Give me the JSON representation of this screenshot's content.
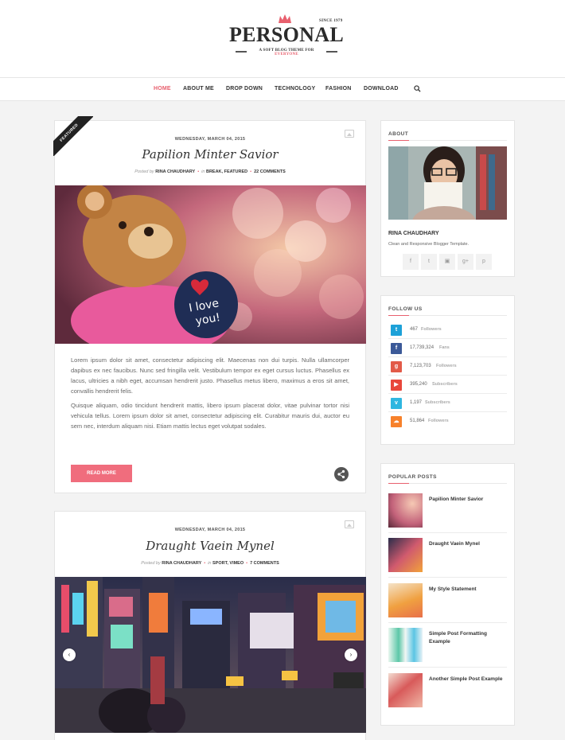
{
  "site": {
    "title": "PERSONAL",
    "since": "SINCE 1979",
    "tagline_prefix": "A SOFT BLOG THEME FOR ",
    "tagline_highlight": "EVERYONE"
  },
  "nav": {
    "items": [
      "HOME",
      "ABOUT ME",
      "DROP DOWN",
      "TECHNOLOGY",
      "FASHION",
      "DOWNLOAD"
    ]
  },
  "posts": [
    {
      "ribbon": "FEATURED",
      "date": "WEDNESDAY, MARCH 04, 2015",
      "title": "Papilion Minter Savior",
      "posted_by_label": "Posted by",
      "author": "RINA CHAUDHARY",
      "in_label": "in",
      "categories": "BREAK, FEATURED",
      "comments": "22 COMMENTS",
      "paragraphs": [
        "Lorem ipsum dolor sit amet, consectetur adipiscing elit. Maecenas non dui turpis. Nulla ullamcorper dapibus ex nec faucibus. Nunc sed fringilla velit. Vestibulum tempor ex eget cursus luctus. Phasellus ex lacus, ultricies a nibh eget, accumsan hendrerit justo. Phasellus metus libero, maximus a eros sit amet, convallis hendrerit felis.",
        "Quisque aliquam, odio tincidunt hendrerit mattis, libero ipsum placerat dolor, vitae pulvinar tortor nisi vehicula tellus. Lorem ipsum dolor sit amet, consectetur adipiscing elit. Curabitur mauris dui, auctor eu sem nec, interdum aliquam nisi. Etiam mattis lectus eget volutpat sodales."
      ],
      "read_more": "READ MORE"
    },
    {
      "date": "WEDNESDAY, MARCH 04, 2015",
      "title": "Draught Vaein Mynel",
      "posted_by_label": "Posted by",
      "author": "RINA CHAUDHARY",
      "in_label": "in",
      "categories": "SPORT, VIMEO",
      "comments": "7 COMMENTS"
    }
  ],
  "about": {
    "title": "ABOUT",
    "name": "RINA CHAUDHARY",
    "description": "Clean and Responsive Blogger Template."
  },
  "follow": {
    "title": "FOLLOW US",
    "rows": [
      {
        "icon": "twitter-icon",
        "count": "467",
        "label": "Followers",
        "color": "#1da1d8"
      },
      {
        "icon": "facebook-icon",
        "count": "17,739,324",
        "label": "Fans",
        "color": "#3b5998"
      },
      {
        "icon": "google-plus-icon",
        "count": "7,123,703",
        "label": "Followers",
        "color": "#e25a48"
      },
      {
        "icon": "youtube-icon",
        "count": "395,240",
        "label": "Subscribers",
        "color": "#e8473b"
      },
      {
        "icon": "vimeo-icon",
        "count": "1,197",
        "label": "Subscribers",
        "color": "#2fb6e0"
      },
      {
        "icon": "soundcloud-icon",
        "count": "51,864",
        "label": "Followers",
        "color": "#f7812b"
      }
    ]
  },
  "popular": {
    "title": "POPULAR POSTS",
    "items": [
      "Papilion Minter Savior",
      "Draught Vaein Mynel",
      "My Style Statement",
      "Simple Post Formatting Example",
      "Another Simple Post Example"
    ]
  },
  "colors": {
    "accent": "#e8606e",
    "button": "#f06d7d"
  }
}
